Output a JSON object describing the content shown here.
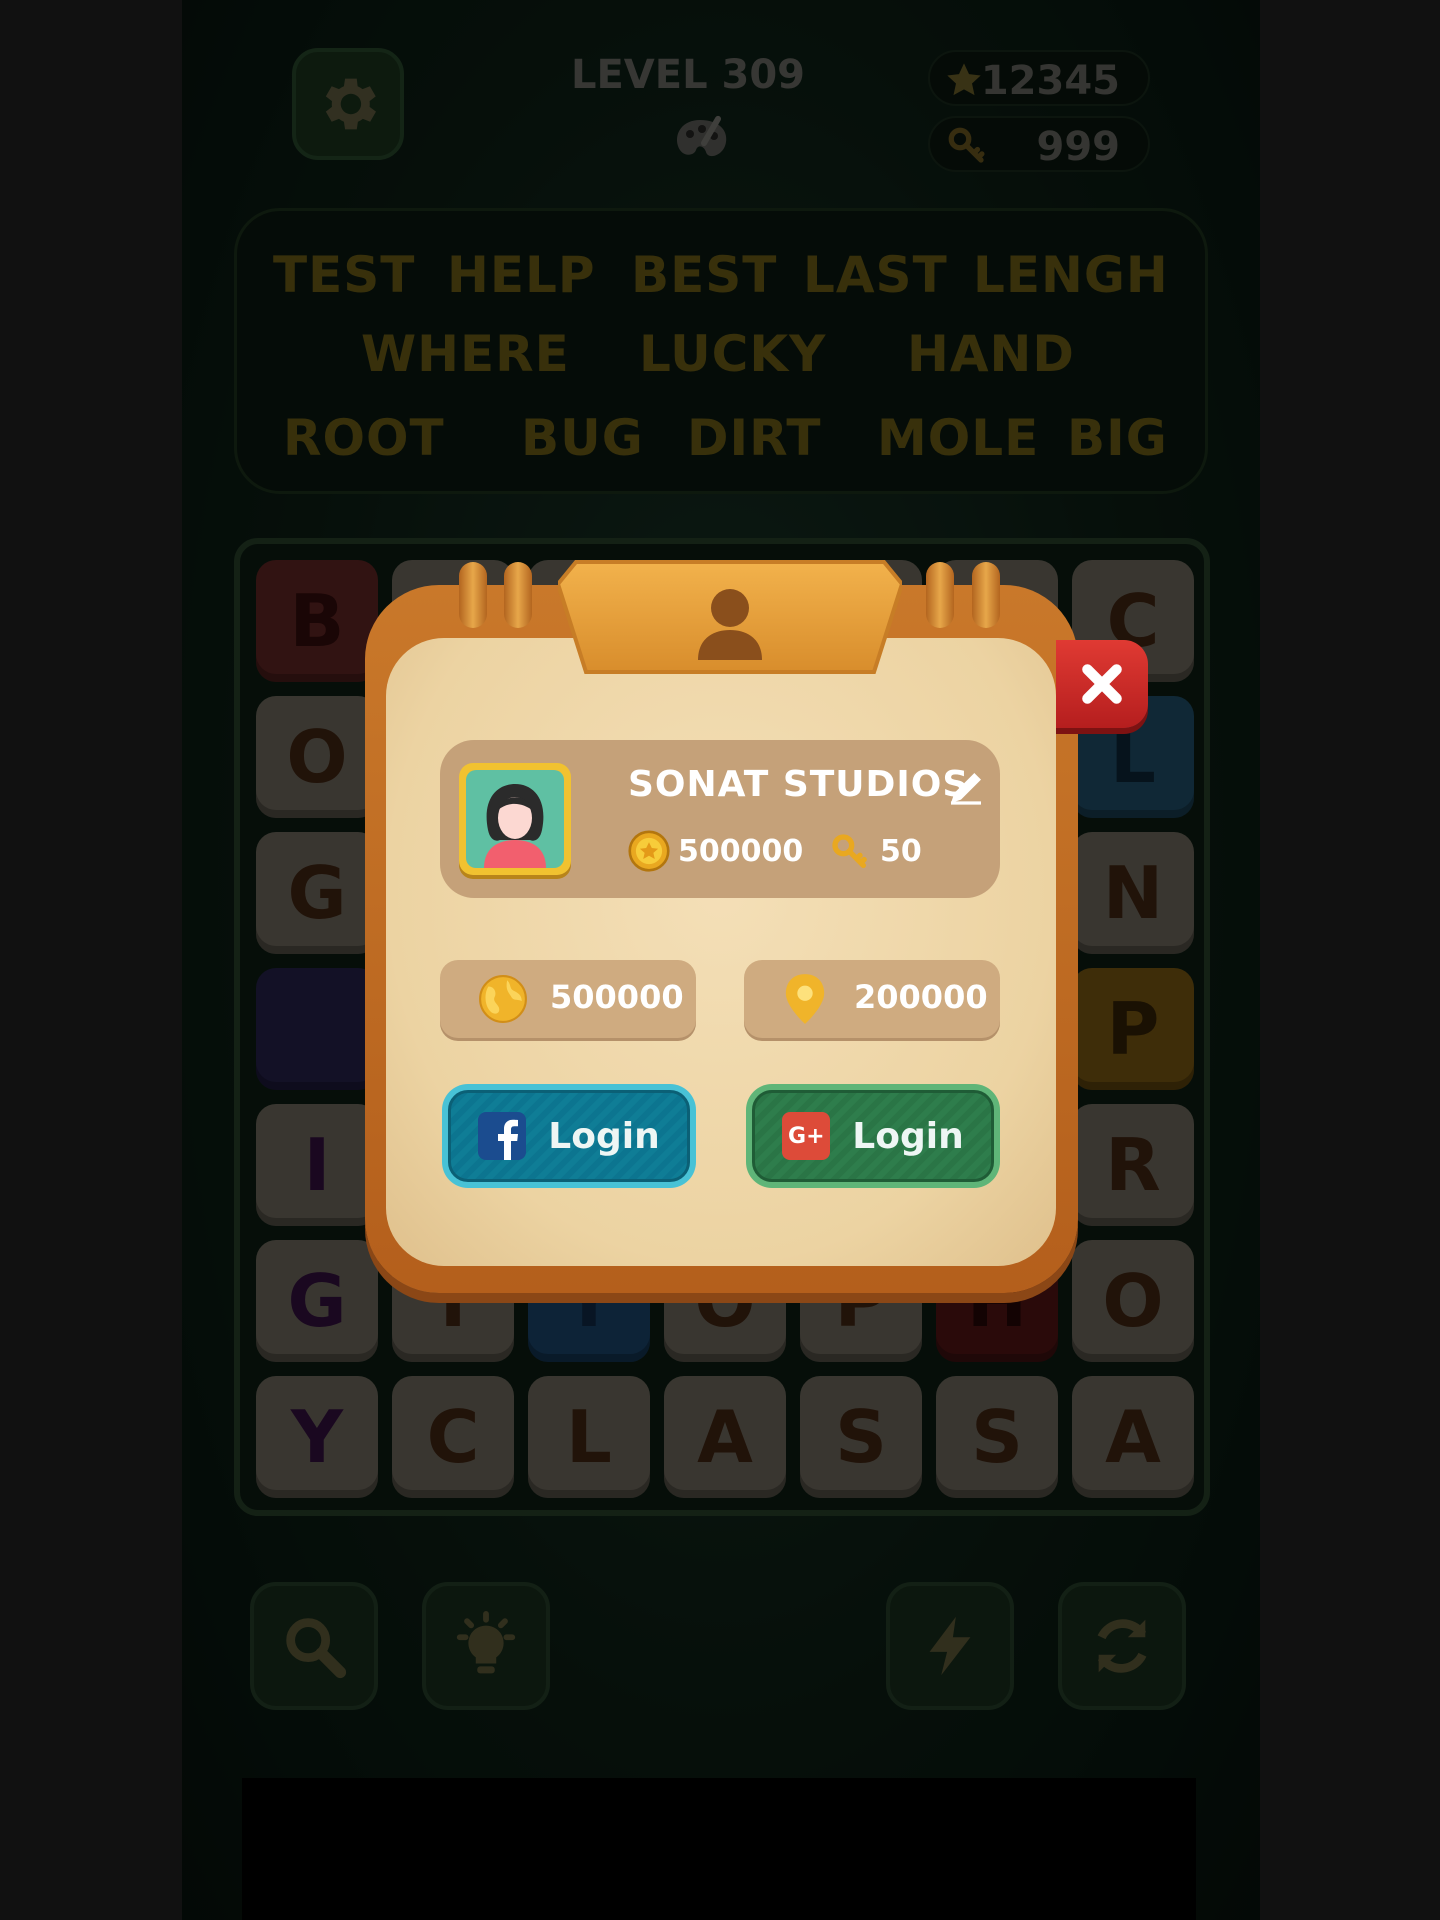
{
  "hud": {
    "level_title": "LEVEL 309",
    "stars": "12345",
    "keys": "999",
    "icons": [
      "settings-gear-icon",
      "palette-icon",
      "star-icon",
      "key-icon"
    ]
  },
  "word_list": [
    "TEST",
    "HELP",
    "BEST",
    "LAST",
    "LENGH",
    "WHERE",
    "LUCKY",
    "HAND",
    "ROOT",
    "BUG",
    "DIRT",
    "MOLE",
    "BIG"
  ],
  "board": {
    "rows": [
      [
        "B",
        "",
        "",
        "",
        "",
        "",
        "C"
      ],
      [
        "O",
        "",
        "",
        "",
        "",
        "",
        "L"
      ],
      [
        "G",
        "",
        "",
        "",
        "",
        "",
        "N"
      ],
      [
        "",
        "",
        "",
        "",
        "",
        "",
        "P"
      ],
      [
        "I",
        "",
        "",
        "",
        "",
        "",
        "R"
      ],
      [
        "G",
        "T",
        "Y",
        "O",
        "P",
        "H",
        "O"
      ],
      [
        "Y",
        "C",
        "L",
        "A",
        "S",
        "S",
        "A"
      ]
    ]
  },
  "profile_popup": {
    "username": "SONAT STUDIOS",
    "coins": "500000",
    "keys": "50",
    "global_score": "500000",
    "local_score": "200000",
    "facebook_login_label": "Login",
    "google_login_label": "Login",
    "google_badge": "G+"
  },
  "tools": [
    "search-icon",
    "lightbulb-icon",
    "lightning-icon",
    "refresh-icon"
  ],
  "colors": {
    "frame_orange": "#c9782a",
    "paper": "#f0d9ad",
    "card_tan": "#c5a179",
    "close_red": "#d42c28",
    "facebook_teal": "#0f7d96",
    "google_green": "#2e7d4c"
  }
}
